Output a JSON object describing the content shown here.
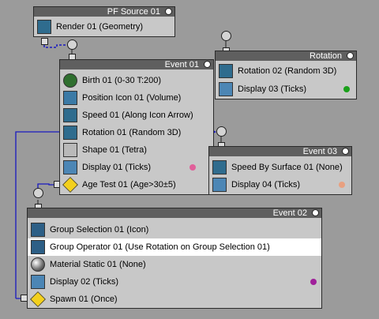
{
  "nodes": {
    "pf_source": {
      "title": "PF Source 01",
      "rows": [
        {
          "label": "Render 01 (Geometry)",
          "icon": "render-geometry-icon"
        }
      ]
    },
    "event01": {
      "title": "Event 01",
      "rows": [
        {
          "label": "Birth 01 (0-30 T:200)",
          "icon": "birth-icon"
        },
        {
          "label": "Position Icon 01 (Volume)",
          "icon": "position-icon"
        },
        {
          "label": "Speed 01 (Along Icon Arrow)",
          "icon": "speed-icon"
        },
        {
          "label": "Rotation 01 (Random 3D)",
          "icon": "rotation-icon"
        },
        {
          "label": "Shape 01 (Tetra)",
          "icon": "shape-icon"
        },
        {
          "label": "Display 01 (Ticks)",
          "icon": "display-icon",
          "color": "#e0609a"
        },
        {
          "label": "Age Test 01 (Age>30±5)",
          "icon": "age-test-icon"
        }
      ]
    },
    "rotation": {
      "title": "Rotation",
      "rows": [
        {
          "label": "Rotation 02 (Random 3D)",
          "icon": "rotation-icon"
        },
        {
          "label": "Display 03 (Ticks)",
          "icon": "display-icon",
          "color": "#1aa01a"
        }
      ]
    },
    "event03": {
      "title": "Event 03",
      "rows": [
        {
          "label": "Speed By Surface 01 (None)",
          "icon": "speed-by-surface-icon"
        },
        {
          "label": "Display 04 (Ticks)",
          "icon": "display-icon",
          "color": "#e8a080"
        }
      ]
    },
    "event02": {
      "title": "Event 02",
      "rows": [
        {
          "label": "Group Selection 01 (Icon)",
          "icon": "group-selection-icon"
        },
        {
          "label": "Group Operator 01 (Use Rotation on Group Selection 01)",
          "icon": "group-operator-icon",
          "selected": true
        },
        {
          "label": "Material Static 01 (None)",
          "icon": "material-icon"
        },
        {
          "label": "Display 02 (Ticks)",
          "icon": "display-icon",
          "color": "#a0209a"
        },
        {
          "label": "Spawn 01 (Once)",
          "icon": "spawn-icon"
        }
      ]
    }
  }
}
